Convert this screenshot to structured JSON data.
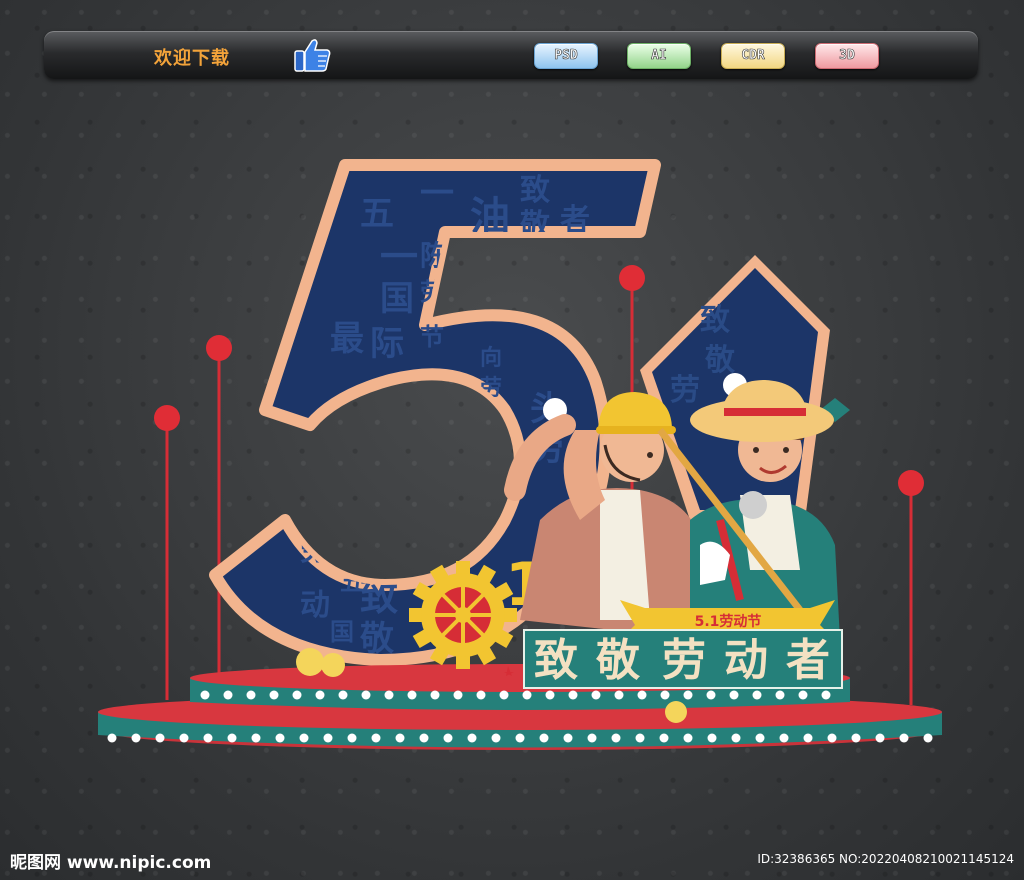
{
  "toolbar": {
    "welcome": "欢迎下载",
    "formats": [
      "PSD",
      "AI",
      "CDR",
      "3D"
    ]
  },
  "poster": {
    "big_number": "5",
    "small_number": "1",
    "headline_chars": [
      "致",
      "敬",
      "劳",
      "动",
      "者"
    ],
    "ribbon": "5.1劳动节",
    "bg_words": [
      "五",
      "一",
      "国",
      "际",
      "劳",
      "动",
      "节",
      "致",
      "敬",
      "劳",
      "动",
      "者",
      "加",
      "油",
      "向",
      "最",
      "美"
    ]
  },
  "watermark": {
    "site": "昵图网 www.nipic.com",
    "id": "ID:32386365 NO:20220408210021145124"
  },
  "icons": {
    "thumb": "thumbs-up-icon",
    "gear": "gear-icon"
  },
  "colors": {
    "navy": "#1c3568",
    "teal": "#25807a",
    "red": "#d62d36",
    "peach": "#f2b48e",
    "gold": "#f2c531"
  }
}
